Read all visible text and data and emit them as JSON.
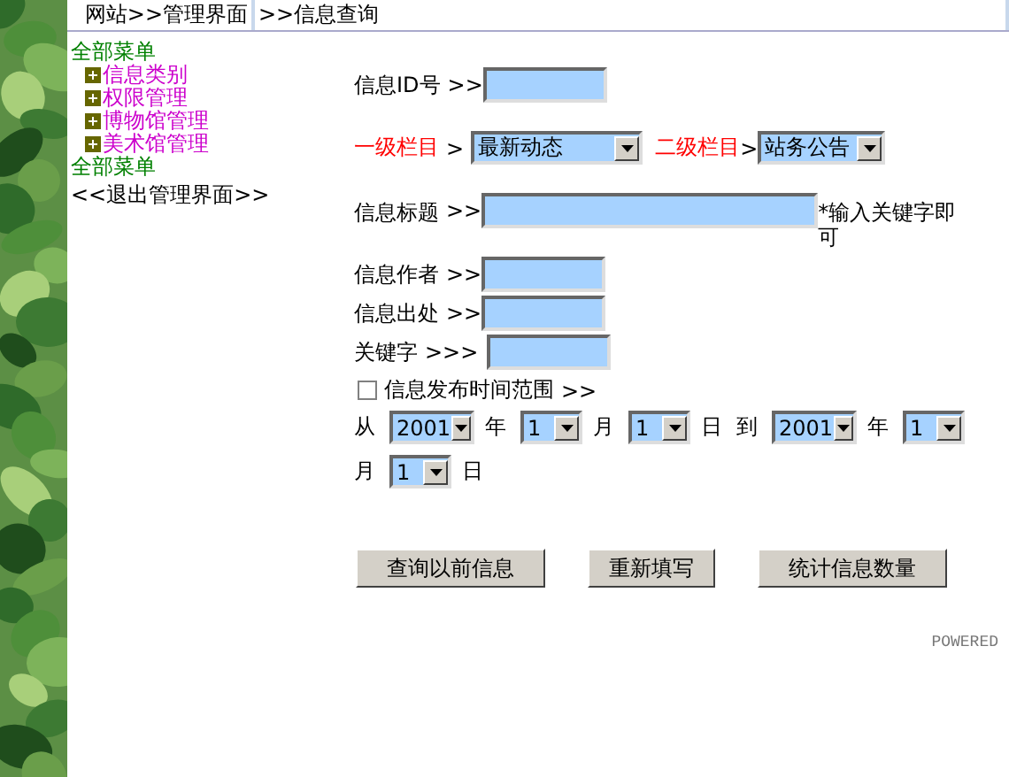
{
  "breadcrumb": [
    {
      "label": "网站>>管理界面"
    },
    {
      "label": ">>信息查询"
    }
  ],
  "menu": {
    "heading": "全部菜单",
    "items": [
      {
        "label": "信息类别",
        "expanded": false
      },
      {
        "label": "权限管理",
        "expanded": false
      },
      {
        "label": "博物馆管理",
        "expanded": false
      },
      {
        "label": "美术馆管理",
        "expanded": false
      }
    ],
    "footer": "全部菜单",
    "exit": "<<退出管理界面>>"
  },
  "form": {
    "id": {
      "label": "信息ID号",
      "arrow": ">>"
    },
    "category": {
      "label1": "一级栏目",
      "arrow1": ">",
      "value1": "最新动态",
      "label2": "二级栏目",
      "arrow2": ">",
      "value2": "站务公告"
    },
    "title": {
      "label": "信息标题",
      "arrow": ">>",
      "hint": "*输入关键字即可"
    },
    "fields": [
      {
        "label": "信息作者",
        "arrow": ">>"
      },
      {
        "label": "信息出处",
        "arrow": ">>"
      },
      {
        "label": "关键字",
        "arrow": ">>>"
      }
    ],
    "range": {
      "label": "信息发布时间范围",
      "arrow": ">>",
      "checked": false
    },
    "dates": [
      {
        "kind": "text",
        "text": "从"
      },
      {
        "kind": "select",
        "value": "2001"
      },
      {
        "kind": "text",
        "text": "年"
      },
      {
        "kind": "select",
        "value": "1"
      },
      {
        "kind": "text",
        "text": "月"
      },
      {
        "kind": "select",
        "value": "1"
      },
      {
        "kind": "text",
        "text": "日"
      },
      {
        "kind": "text",
        "text": "到"
      },
      {
        "kind": "select",
        "value": "2001"
      },
      {
        "kind": "text",
        "text": "年"
      },
      {
        "kind": "select",
        "value": "1"
      },
      {
        "kind": "break"
      },
      {
        "kind": "text",
        "text": "月"
      },
      {
        "kind": "select",
        "value": "1"
      },
      {
        "kind": "text",
        "text": "日"
      }
    ],
    "buttons": [
      "查询以前信息",
      "重新填写",
      "统计信息数量"
    ]
  },
  "footer": "POWERED"
}
